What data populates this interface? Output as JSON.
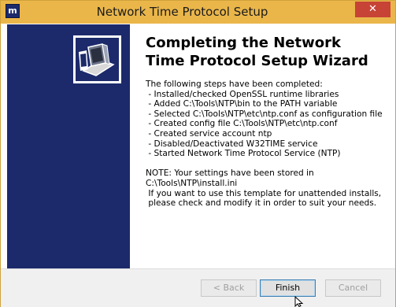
{
  "window": {
    "title": "Network Time Protocol Setup",
    "app_icon_glyph": "m",
    "close_glyph": "✕"
  },
  "wizard": {
    "heading": "Completing the Network Time Protocol Setup Wizard",
    "body": "The following steps have been completed:\n - Installed/checked OpenSSL runtime libraries\n - Added C:\\Tools\\NTP\\bin to the PATH variable\n - Selected C:\\Tools\\NTP\\etc\\ntp.conf as configuration file\n - Created config file C:\\Tools\\NTP\\etc\\ntp.conf\n - Created service account ntp\n - Disabled/Deactivated W32TIME service\n - Started Network Time Protocol Service (NTP)\n\nNOTE: Your settings have been stored in\nC:\\Tools\\NTP\\install.ini\n If you want to use this template for unattended installs,\n please check and modify it in order to suit your needs."
  },
  "buttons": {
    "back": "< Back",
    "finish": "Finish",
    "cancel": "Cancel"
  },
  "colors": {
    "titlebar": "#eab64a",
    "banner": "#1c2a6b",
    "close": "#c74336"
  },
  "icons": {
    "banner": "ntp-computer-logo-icon",
    "cursor": "mouse-pointer-icon"
  }
}
